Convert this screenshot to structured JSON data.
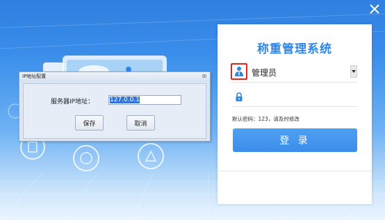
{
  "window": {
    "close_icon": "close-icon"
  },
  "login": {
    "title": "称重管理系统",
    "username": "管理员",
    "password": "",
    "hint": "默认密码：123，请及时修改",
    "login_label": "登 录",
    "user_icon": "user-icon",
    "lock_icon": "lock-icon",
    "dropdown_icon": "chevron-down-icon",
    "accent_color": "#2f86e8"
  },
  "ip_dialog": {
    "title": "IP地址配置",
    "ip_label": "服务器IP地址：",
    "ip_value": "127.0.0.1",
    "save_label": "保存",
    "cancel_label": "取消",
    "close_glyph": "☒"
  }
}
